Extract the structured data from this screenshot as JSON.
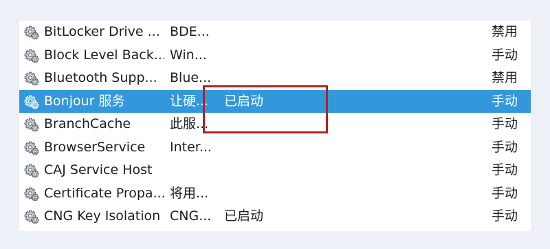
{
  "services": [
    {
      "name": "BitLocker Drive ...",
      "description": "BDE...",
      "status": "",
      "startup": "禁用",
      "icon": "gear-icon"
    },
    {
      "name": "Block Level Back...",
      "description": "Win...",
      "status": "",
      "startup": "手动",
      "icon": "gear-icon"
    },
    {
      "name": "Bluetooth Supp...",
      "description": "Blue...",
      "status": "",
      "startup": "禁用",
      "icon": "gear-icon"
    },
    {
      "name": "Bonjour 服务",
      "description": "让硬...",
      "status": "已启动",
      "startup": "手动",
      "icon": "gear-icon"
    },
    {
      "name": "BranchCache",
      "description": "此服...",
      "status": "",
      "startup": "手动",
      "icon": "gear-icon"
    },
    {
      "name": "BrowserService",
      "description": "Inter...",
      "status": "",
      "startup": "手动",
      "icon": "gear-icon"
    },
    {
      "name": "CAJ Service Host",
      "description": "",
      "status": "",
      "startup": "手动",
      "icon": "gear-icon"
    },
    {
      "name": "Certificate Propa...",
      "description": "将用...",
      "status": "",
      "startup": "手动",
      "icon": "gear-icon"
    },
    {
      "name": "CNG Key Isolation",
      "description": "CNG...",
      "status": "已启动",
      "startup": "手动",
      "icon": "gear-icon"
    }
  ],
  "selected_index": 3,
  "colors": {
    "selection": "#3398db",
    "highlight_box": "#b42222",
    "background": "#eef0f7"
  }
}
